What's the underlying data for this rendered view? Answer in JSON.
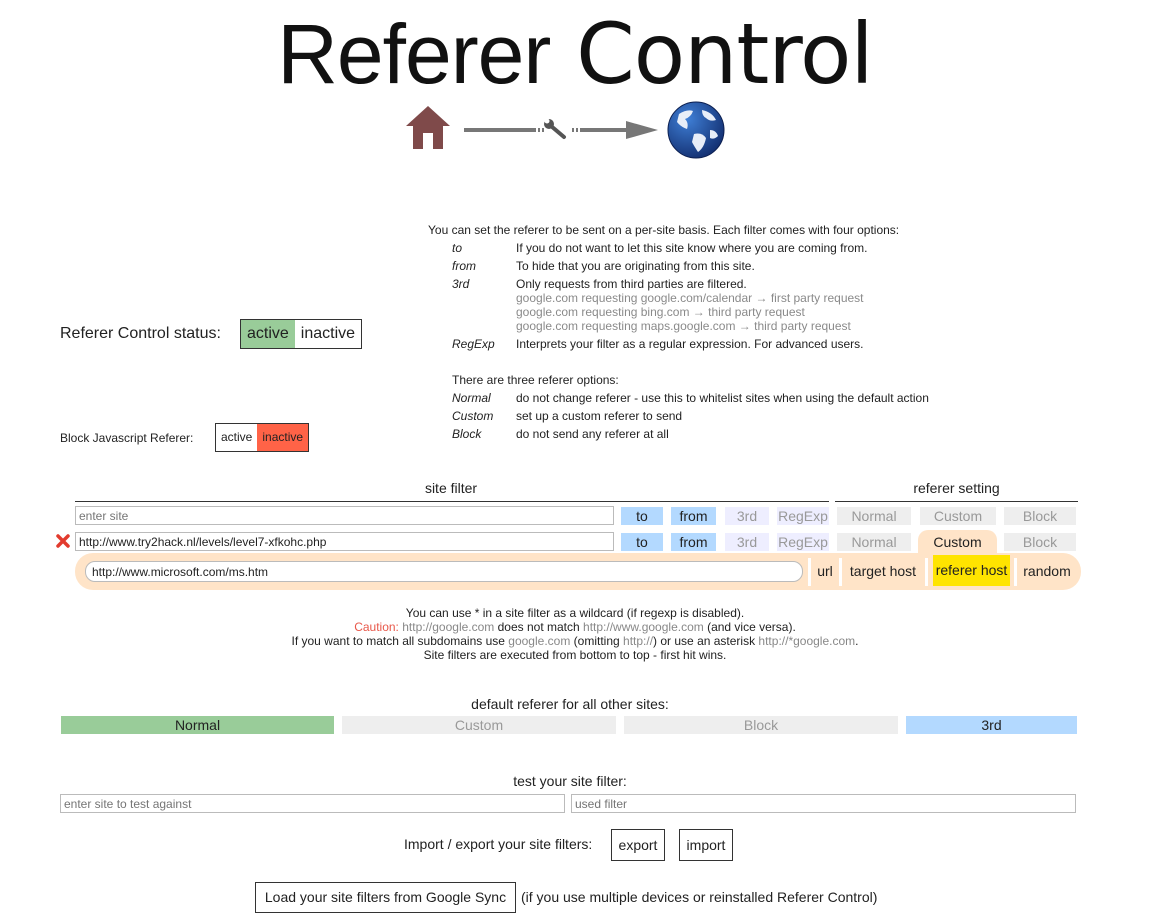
{
  "header": {
    "title_part1": "Referer",
    "title_part2": "Control",
    "logo_icons": [
      "home-icon",
      "wrench-icon",
      "arrow-right-icon",
      "globe-icon"
    ]
  },
  "help": {
    "intro": "You can set the referer to be sent on a per-site basis. Each filter comes with four options:",
    "filter_options": [
      {
        "key": "to",
        "desc": "If you do not want to let this site know where you are coming from."
      },
      {
        "key": "from",
        "desc": "To hide that you are originating from this site."
      },
      {
        "key": "3rd",
        "desc": "Only requests from third parties are filtered.",
        "examples": [
          "google.com requesting google.com/calendar → first party request",
          "google.com requesting bing.com → third party request",
          "google.com requesting maps.google.com → third party request"
        ]
      },
      {
        "key": "RegExp",
        "desc": "Interprets your filter as a regular expression. For advanced users."
      }
    ],
    "referer_intro": "There are three referer options:",
    "referer_options": [
      {
        "key": "Normal",
        "desc": "do not change referer - use this to whitelist sites when using the default action"
      },
      {
        "key": "Custom",
        "desc": "set up a custom referer to send"
      },
      {
        "key": "Block",
        "desc": "do not send any referer at all"
      }
    ]
  },
  "status": {
    "label": "Referer Control status:",
    "active": "active",
    "inactive": "inactive",
    "selected": "active"
  },
  "block_js": {
    "label": "Block Javascript Referer:",
    "active": "active",
    "inactive": "inactive",
    "selected": "inactive"
  },
  "filters": {
    "site_filter_header": "site filter",
    "referer_setting_header": "referer setting",
    "new_row": {
      "placeholder": "enter site",
      "value": "",
      "options": {
        "to": "to",
        "from": "from",
        "third": "3rd",
        "regexp": "RegExp"
      },
      "referer": {
        "normal": "Normal",
        "custom": "Custom",
        "block": "Block"
      }
    },
    "rows": [
      {
        "site": "http://www.try2hack.nl/levels/level7-xfkohc.php",
        "options": {
          "to": "to",
          "from": "from",
          "third": "3rd",
          "regexp": "RegExp"
        },
        "referer": {
          "normal": "Normal",
          "custom": "Custom",
          "block": "Block"
        },
        "selected_referer": "Custom",
        "custom_referer": "http://www.microsoft.com/ms.htm",
        "custom_options": [
          "url",
          "target host",
          "referer host",
          "random"
        ],
        "custom_selected": "referer host"
      }
    ]
  },
  "notes": {
    "line1": "You can use * in a site filter as a wildcard (if regexp is disabled).",
    "line2_caution": "Caution:",
    "line2_a": "http://google.com",
    "line2_b": " does not match ",
    "line2_c": "http://www.google.com",
    "line2_d": " (and vice versa).",
    "line3_a": "If you want to match all subdomains use ",
    "line3_b": "google.com",
    "line3_c": " (omitting ",
    "line3_d": "http://",
    "line3_e": ") or use an asterisk ",
    "line3_f": "http://*google.com",
    "line3_g": ".",
    "line4": "Site filters are executed from bottom to top - first hit wins."
  },
  "default_referer": {
    "label": "default referer for all other sites:",
    "options": [
      "Normal",
      "Custom",
      "Block",
      "3rd"
    ],
    "selected": "Normal",
    "third_enabled": true
  },
  "test": {
    "label": "test your site filter:",
    "site_placeholder": "enter site to test against",
    "used_filter_placeholder": "used filter"
  },
  "import_export": {
    "label": "Import / export your site filters:",
    "export": "export",
    "import": "import"
  },
  "sync": {
    "button": "Load your site filters from Google Sync",
    "note": "(if you use multiple devices or reinstalled Referer Control)"
  },
  "colors": {
    "active_green": "#99cc99",
    "inactive_red": "#ff6347",
    "option_blue": "#b3d9ff",
    "option_lavender": "#eeeeff",
    "option_gray": "#eeeeee",
    "custom_peach": "#ffe4c8",
    "highlight_yellow": "#ffe400",
    "caution_red": "#e8584a"
  }
}
